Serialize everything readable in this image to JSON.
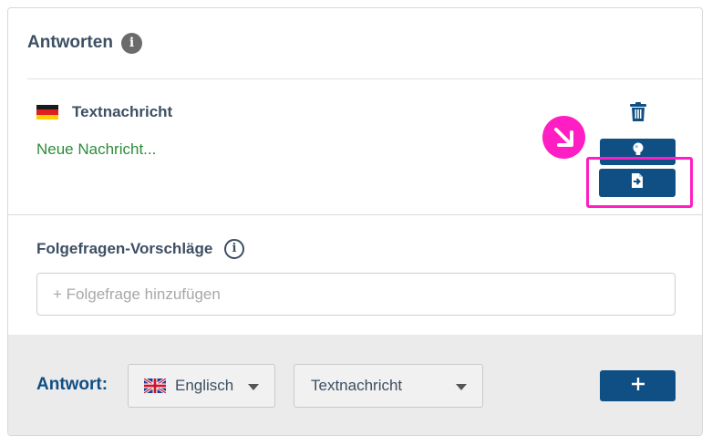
{
  "section": {
    "title": "Antworten"
  },
  "response": {
    "type_label": "Textnachricht",
    "message": "Neue Nachricht..."
  },
  "followups": {
    "label": "Folgefragen-Vorschläge",
    "placeholder": "+ Folgefrage hinzufügen"
  },
  "footer": {
    "label": "Antwort:",
    "language_value": "Englisch",
    "type_value": "Textnachricht",
    "add_button": "+"
  },
  "colors": {
    "primary": "#0f4f84",
    "highlight": "#ff1ec3",
    "message_text": "#2e8b3a"
  },
  "icons": {
    "info": "info-icon",
    "trash": "trash-icon",
    "bulb": "lightbulb-icon",
    "import": "file-import-icon",
    "cursor": "arrow-down-right-icon",
    "flag_de": "flag-germany-icon",
    "flag_uk": "flag-uk-icon",
    "caret": "chevron-down-icon"
  }
}
